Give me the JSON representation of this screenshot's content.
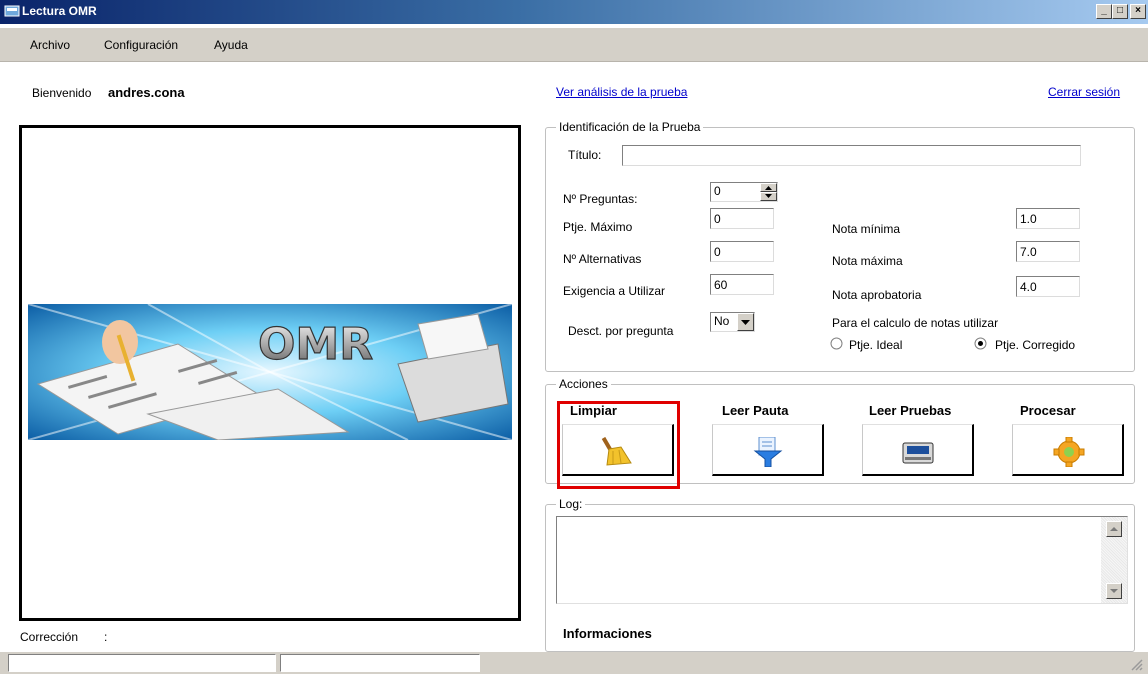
{
  "window": {
    "title": "Lectura OMR"
  },
  "menu": {
    "items": [
      "Archivo",
      "Configuración",
      "Ayuda"
    ]
  },
  "header": {
    "welcome_label": "Bienvenido",
    "username": "andres.cona",
    "analysis_link": "Ver análisis de la prueba",
    "logout_link": "Cerrar sesión"
  },
  "image_panel": {
    "banner_text": "OMR"
  },
  "footer": {
    "correction_label": "Corrección",
    "correction_colon": ":"
  },
  "identification": {
    "legend": "Identificación de la Prueba",
    "title_label": "Título:",
    "title_value": "",
    "num_questions_label": "Nº Preguntas:",
    "num_questions_value": "0",
    "max_score_label": "Ptje. Máximo",
    "max_score_value": "0",
    "num_alternatives_label": "Nº Alternativas",
    "num_alternatives_value": "0",
    "requirement_label": "Exigencia a Utilizar",
    "requirement_value": "60",
    "discount_label": "Desct. por pregunta",
    "discount_value": "No",
    "min_grade_label": "Nota mínima",
    "min_grade_value": "1.0",
    "max_grade_label": "Nota máxima",
    "max_grade_value": "7.0",
    "pass_grade_label": "Nota aprobatoria",
    "pass_grade_value": "4.0",
    "calc_label": "Para el calculo de notas utilizar",
    "radio_ideal": "Ptje. Ideal",
    "radio_corrected": "Ptje. Corregido",
    "selected_option": "Ptje. Corregido"
  },
  "actions": {
    "legend": "Acciones",
    "buttons": [
      {
        "label": "Limpiar",
        "icon": "broom-icon"
      },
      {
        "label": "Leer Pauta",
        "icon": "document-funnel-icon"
      },
      {
        "label": "Leer Pruebas",
        "icon": "scanner-icon"
      },
      {
        "label": "Procesar",
        "icon": "gear-icon"
      }
    ]
  },
  "log": {
    "legend": "Log:",
    "info_label": "Informaciones"
  },
  "colors": {
    "highlight": "#e00000",
    "link": "#0000cc",
    "titlebar_start": "#0a246a"
  }
}
